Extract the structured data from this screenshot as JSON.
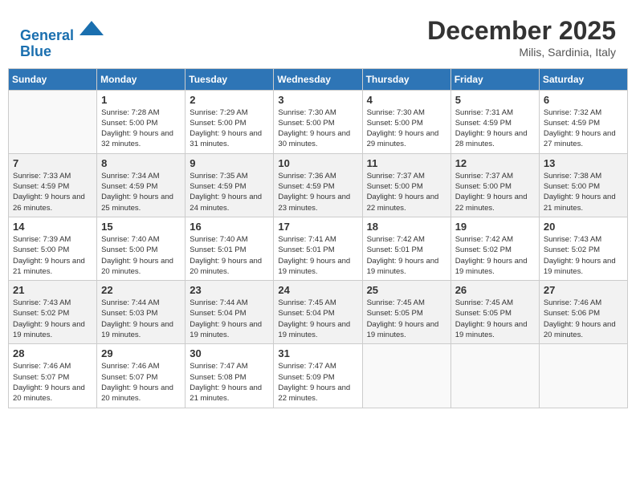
{
  "header": {
    "logo_line1": "General",
    "logo_line2": "Blue",
    "month_title": "December 2025",
    "location": "Milis, Sardinia, Italy"
  },
  "calendar": {
    "days_of_week": [
      "Sunday",
      "Monday",
      "Tuesday",
      "Wednesday",
      "Thursday",
      "Friday",
      "Saturday"
    ],
    "weeks": [
      [
        {
          "day": "",
          "sunrise": "",
          "sunset": "",
          "daylight": ""
        },
        {
          "day": "1",
          "sunrise": "Sunrise: 7:28 AM",
          "sunset": "Sunset: 5:00 PM",
          "daylight": "Daylight: 9 hours and 32 minutes."
        },
        {
          "day": "2",
          "sunrise": "Sunrise: 7:29 AM",
          "sunset": "Sunset: 5:00 PM",
          "daylight": "Daylight: 9 hours and 31 minutes."
        },
        {
          "day": "3",
          "sunrise": "Sunrise: 7:30 AM",
          "sunset": "Sunset: 5:00 PM",
          "daylight": "Daylight: 9 hours and 30 minutes."
        },
        {
          "day": "4",
          "sunrise": "Sunrise: 7:30 AM",
          "sunset": "Sunset: 5:00 PM",
          "daylight": "Daylight: 9 hours and 29 minutes."
        },
        {
          "day": "5",
          "sunrise": "Sunrise: 7:31 AM",
          "sunset": "Sunset: 4:59 PM",
          "daylight": "Daylight: 9 hours and 28 minutes."
        },
        {
          "day": "6",
          "sunrise": "Sunrise: 7:32 AM",
          "sunset": "Sunset: 4:59 PM",
          "daylight": "Daylight: 9 hours and 27 minutes."
        }
      ],
      [
        {
          "day": "7",
          "sunrise": "Sunrise: 7:33 AM",
          "sunset": "Sunset: 4:59 PM",
          "daylight": "Daylight: 9 hours and 26 minutes."
        },
        {
          "day": "8",
          "sunrise": "Sunrise: 7:34 AM",
          "sunset": "Sunset: 4:59 PM",
          "daylight": "Daylight: 9 hours and 25 minutes."
        },
        {
          "day": "9",
          "sunrise": "Sunrise: 7:35 AM",
          "sunset": "Sunset: 4:59 PM",
          "daylight": "Daylight: 9 hours and 24 minutes."
        },
        {
          "day": "10",
          "sunrise": "Sunrise: 7:36 AM",
          "sunset": "Sunset: 4:59 PM",
          "daylight": "Daylight: 9 hours and 23 minutes."
        },
        {
          "day": "11",
          "sunrise": "Sunrise: 7:37 AM",
          "sunset": "Sunset: 5:00 PM",
          "daylight": "Daylight: 9 hours and 22 minutes."
        },
        {
          "day": "12",
          "sunrise": "Sunrise: 7:37 AM",
          "sunset": "Sunset: 5:00 PM",
          "daylight": "Daylight: 9 hours and 22 minutes."
        },
        {
          "day": "13",
          "sunrise": "Sunrise: 7:38 AM",
          "sunset": "Sunset: 5:00 PM",
          "daylight": "Daylight: 9 hours and 21 minutes."
        }
      ],
      [
        {
          "day": "14",
          "sunrise": "Sunrise: 7:39 AM",
          "sunset": "Sunset: 5:00 PM",
          "daylight": "Daylight: 9 hours and 21 minutes."
        },
        {
          "day": "15",
          "sunrise": "Sunrise: 7:40 AM",
          "sunset": "Sunset: 5:00 PM",
          "daylight": "Daylight: 9 hours and 20 minutes."
        },
        {
          "day": "16",
          "sunrise": "Sunrise: 7:40 AM",
          "sunset": "Sunset: 5:01 PM",
          "daylight": "Daylight: 9 hours and 20 minutes."
        },
        {
          "day": "17",
          "sunrise": "Sunrise: 7:41 AM",
          "sunset": "Sunset: 5:01 PM",
          "daylight": "Daylight: 9 hours and 19 minutes."
        },
        {
          "day": "18",
          "sunrise": "Sunrise: 7:42 AM",
          "sunset": "Sunset: 5:01 PM",
          "daylight": "Daylight: 9 hours and 19 minutes."
        },
        {
          "day": "19",
          "sunrise": "Sunrise: 7:42 AM",
          "sunset": "Sunset: 5:02 PM",
          "daylight": "Daylight: 9 hours and 19 minutes."
        },
        {
          "day": "20",
          "sunrise": "Sunrise: 7:43 AM",
          "sunset": "Sunset: 5:02 PM",
          "daylight": "Daylight: 9 hours and 19 minutes."
        }
      ],
      [
        {
          "day": "21",
          "sunrise": "Sunrise: 7:43 AM",
          "sunset": "Sunset: 5:02 PM",
          "daylight": "Daylight: 9 hours and 19 minutes."
        },
        {
          "day": "22",
          "sunrise": "Sunrise: 7:44 AM",
          "sunset": "Sunset: 5:03 PM",
          "daylight": "Daylight: 9 hours and 19 minutes."
        },
        {
          "day": "23",
          "sunrise": "Sunrise: 7:44 AM",
          "sunset": "Sunset: 5:04 PM",
          "daylight": "Daylight: 9 hours and 19 minutes."
        },
        {
          "day": "24",
          "sunrise": "Sunrise: 7:45 AM",
          "sunset": "Sunset: 5:04 PM",
          "daylight": "Daylight: 9 hours and 19 minutes."
        },
        {
          "day": "25",
          "sunrise": "Sunrise: 7:45 AM",
          "sunset": "Sunset: 5:05 PM",
          "daylight": "Daylight: 9 hours and 19 minutes."
        },
        {
          "day": "26",
          "sunrise": "Sunrise: 7:45 AM",
          "sunset": "Sunset: 5:05 PM",
          "daylight": "Daylight: 9 hours and 19 minutes."
        },
        {
          "day": "27",
          "sunrise": "Sunrise: 7:46 AM",
          "sunset": "Sunset: 5:06 PM",
          "daylight": "Daylight: 9 hours and 20 minutes."
        }
      ],
      [
        {
          "day": "28",
          "sunrise": "Sunrise: 7:46 AM",
          "sunset": "Sunset: 5:07 PM",
          "daylight": "Daylight: 9 hours and 20 minutes."
        },
        {
          "day": "29",
          "sunrise": "Sunrise: 7:46 AM",
          "sunset": "Sunset: 5:07 PM",
          "daylight": "Daylight: 9 hours and 20 minutes."
        },
        {
          "day": "30",
          "sunrise": "Sunrise: 7:47 AM",
          "sunset": "Sunset: 5:08 PM",
          "daylight": "Daylight: 9 hours and 21 minutes."
        },
        {
          "day": "31",
          "sunrise": "Sunrise: 7:47 AM",
          "sunset": "Sunset: 5:09 PM",
          "daylight": "Daylight: 9 hours and 22 minutes."
        },
        {
          "day": "",
          "sunrise": "",
          "sunset": "",
          "daylight": ""
        },
        {
          "day": "",
          "sunrise": "",
          "sunset": "",
          "daylight": ""
        },
        {
          "day": "",
          "sunrise": "",
          "sunset": "",
          "daylight": ""
        }
      ]
    ]
  }
}
